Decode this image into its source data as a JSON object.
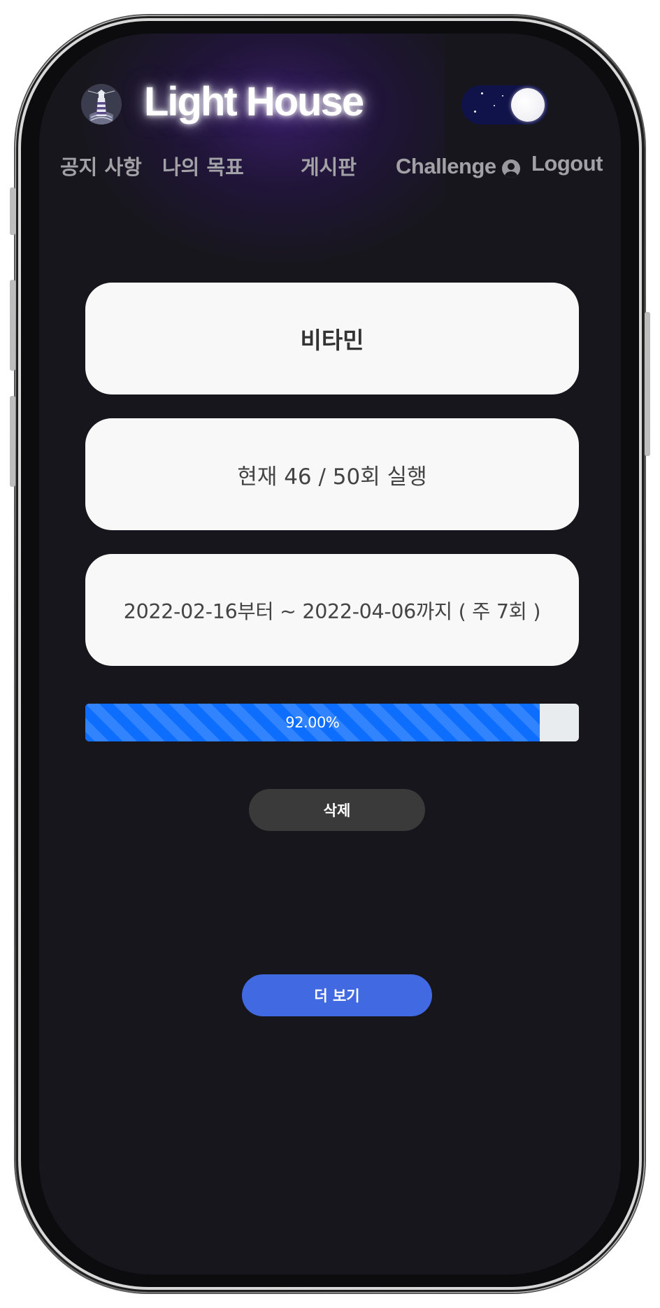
{
  "header": {
    "brand_title": "Light House",
    "theme_toggle": "dark",
    "nav": {
      "notice": "공지 사항",
      "my_goal": "나의 목표",
      "board": "게시판",
      "challenge": "Challenge",
      "logout": "Logout"
    }
  },
  "goal": {
    "name": "비타민",
    "progress_text": "현재 46 / 50회 실행",
    "period_text": "2022-02-16부터 ~ 2022-04-06까지 ( 주 7회 )",
    "progress_percent": 92,
    "progress_label": "92.00%"
  },
  "actions": {
    "delete_label": "삭제",
    "more_label": "더 보기"
  },
  "colors": {
    "background": "#17161c",
    "card": "#f8f8f8",
    "progress_fill": "#0d6efd",
    "progress_track": "#e9ecef",
    "delete_button": "#3a3a3a",
    "more_button": "#4169e1",
    "toggle_track": "#10124a"
  }
}
